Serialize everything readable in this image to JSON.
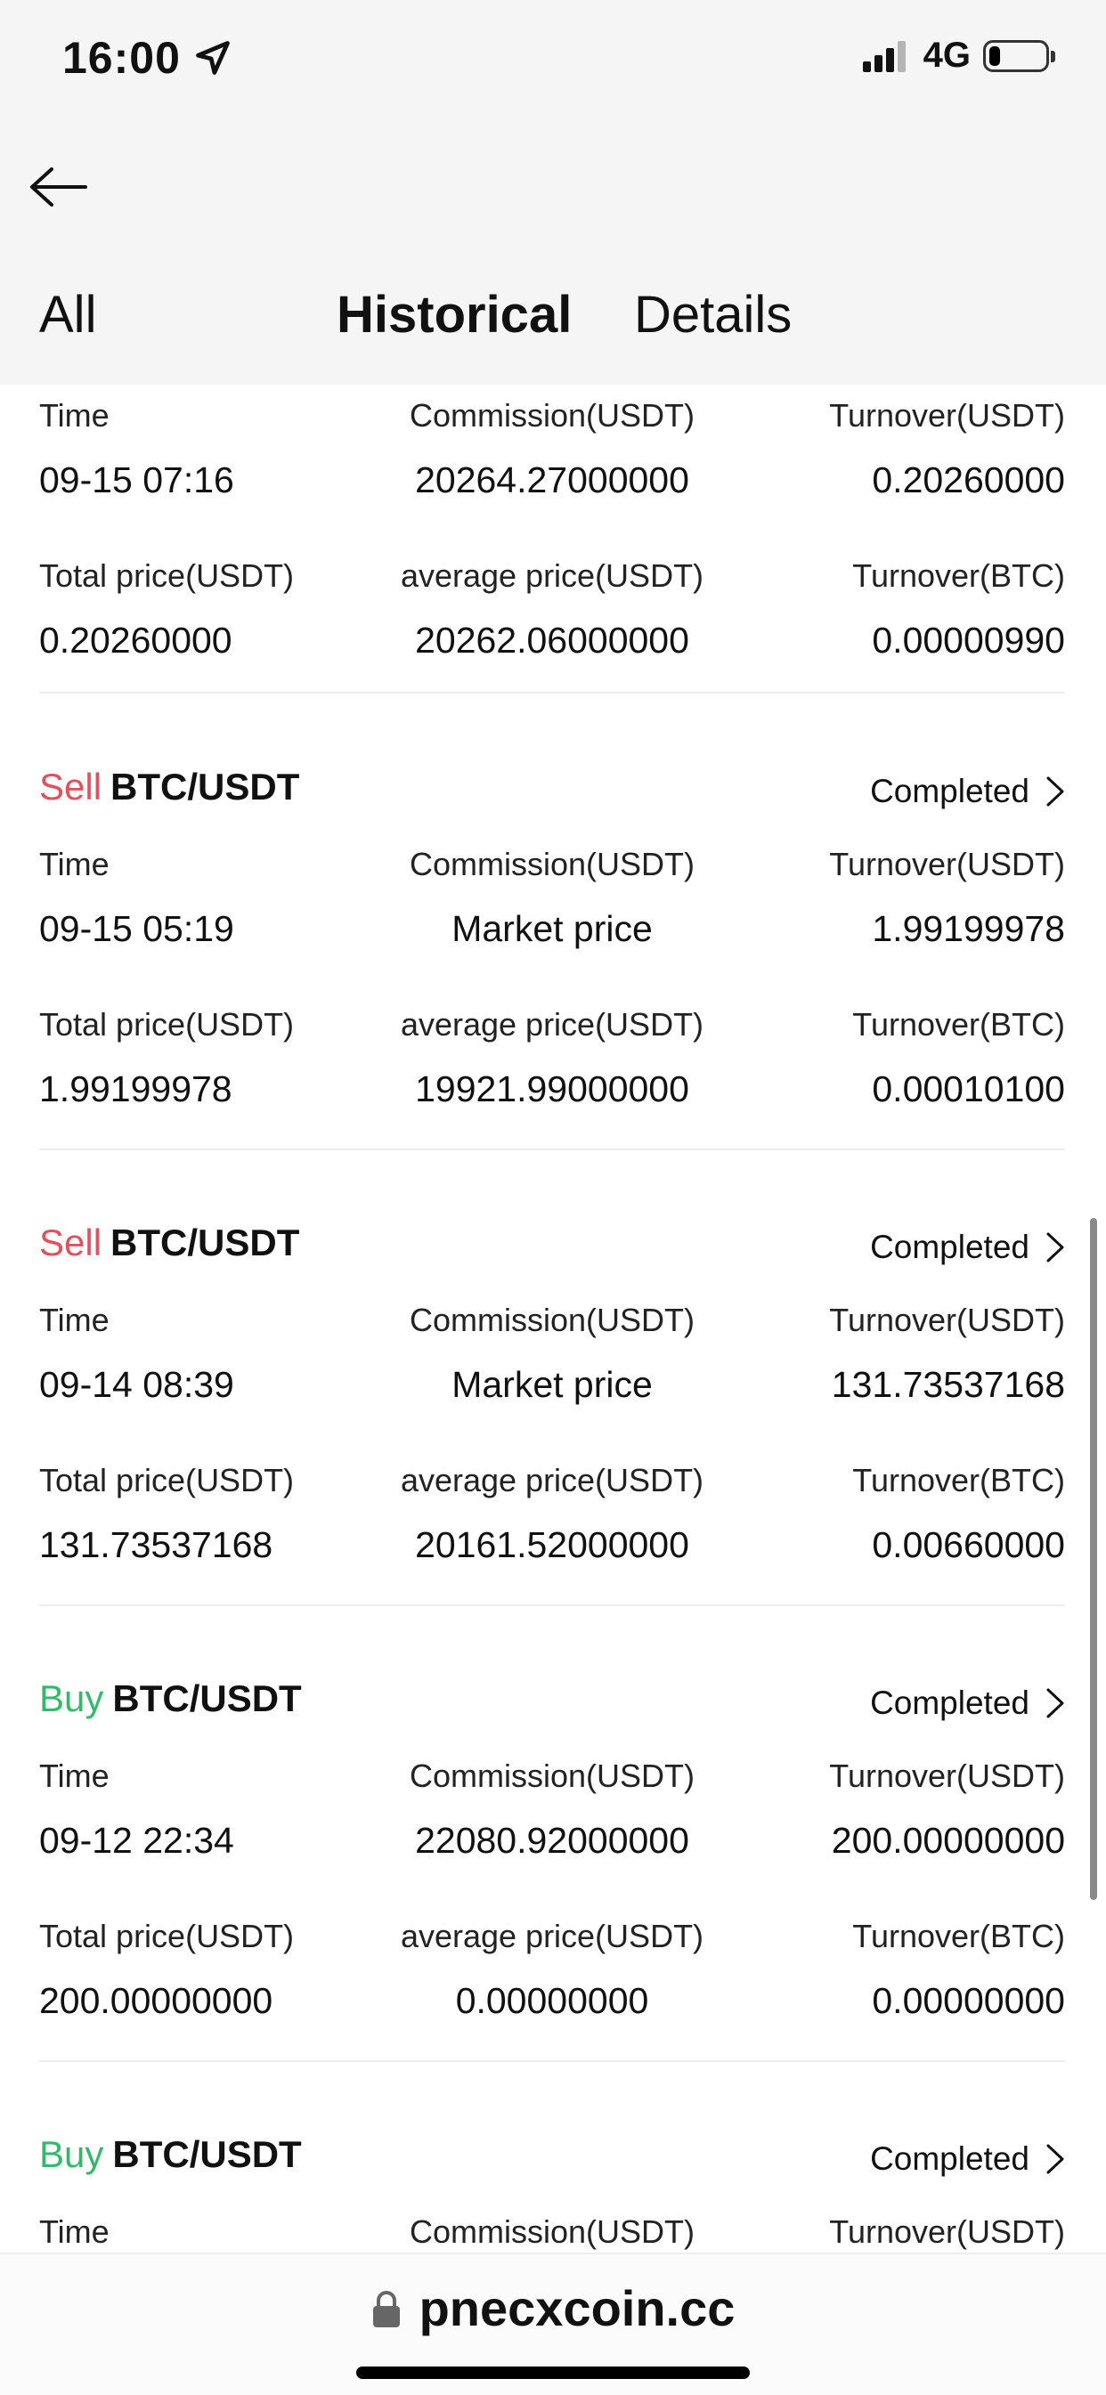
{
  "status_bar": {
    "time": "16:00",
    "network": "4G",
    "battery_level": 0.2
  },
  "header": {
    "back_icon": "arrow-left-icon",
    "tabs": [
      "All",
      "Historical",
      "Details"
    ],
    "active_tab": "Historical"
  },
  "orders": [
    {
      "side": "",
      "pair": "",
      "status": "",
      "labels1": [
        "Time",
        "Commission(USDT)",
        "Turnover(USDT)"
      ],
      "values1": [
        "09-15 07:16",
        "20264.27000000",
        "0.20260000"
      ],
      "labels2": [
        "Total price(USDT)",
        "average price(USDT)",
        "Turnover(BTC)"
      ],
      "values2": [
        "0.20260000",
        "20262.06000000",
        "0.00000990"
      ]
    },
    {
      "side": "Sell",
      "pair": "BTC/USDT",
      "status": "Completed",
      "labels1": [
        "Time",
        "Commission(USDT)",
        "Turnover(USDT)"
      ],
      "values1": [
        "09-15 05:19",
        "Market price",
        "1.99199978"
      ],
      "labels2": [
        "Total price(USDT)",
        "average price(USDT)",
        "Turnover(BTC)"
      ],
      "values2": [
        "1.99199978",
        "19921.99000000",
        "0.00010100"
      ]
    },
    {
      "side": "Sell",
      "pair": "BTC/USDT",
      "status": "Completed",
      "labels1": [
        "Time",
        "Commission(USDT)",
        "Turnover(USDT)"
      ],
      "values1": [
        "09-14 08:39",
        "Market price",
        "131.73537168"
      ],
      "labels2": [
        "Total price(USDT)",
        "average price(USDT)",
        "Turnover(BTC)"
      ],
      "values2": [
        "131.73537168",
        "20161.52000000",
        "0.00660000"
      ]
    },
    {
      "side": "Buy",
      "pair": "BTC/USDT",
      "status": "Completed",
      "labels1": [
        "Time",
        "Commission(USDT)",
        "Turnover(USDT)"
      ],
      "values1": [
        "09-12 22:34",
        "22080.92000000",
        "200.00000000"
      ],
      "labels2": [
        "Total price(USDT)",
        "average price(USDT)",
        "Turnover(BTC)"
      ],
      "values2": [
        "200.00000000",
        "0.00000000",
        "0.00000000"
      ]
    },
    {
      "side": "Buy",
      "pair": "BTC/USDT",
      "status": "Completed",
      "labels1": [
        "Time",
        "Commission(USDT)",
        "Turnover(USDT)"
      ],
      "values1": [
        "",
        "",
        ""
      ],
      "labels2": [
        "",
        "",
        ""
      ],
      "values2": [
        "",
        "",
        ""
      ]
    }
  ],
  "browser": {
    "url": "pnecxcoin.cc",
    "lock_icon": "lock-icon"
  },
  "colors": {
    "sell": "#e2505c",
    "buy": "#36b86b",
    "header_bg": "#f5f5f5"
  }
}
